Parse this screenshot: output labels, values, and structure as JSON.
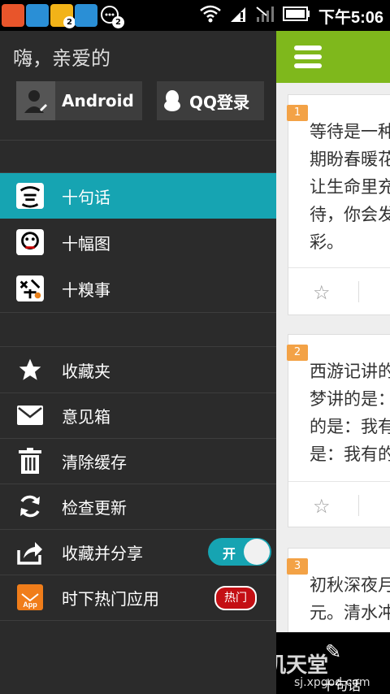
{
  "status_bar": {
    "time": "下午5:06",
    "notification_counts": [
      "2",
      "2"
    ]
  },
  "drawer": {
    "greeting": "嗨，亲爱的",
    "login_android": "Android",
    "login_qq": "QQ登录",
    "categories": [
      {
        "label": "十句话",
        "active": true
      },
      {
        "label": "十幅图",
        "active": false
      },
      {
        "label": "十糗事",
        "active": false
      }
    ],
    "menu": [
      {
        "label": "收藏夹"
      },
      {
        "label": "意见箱"
      },
      {
        "label": "清除缓存"
      },
      {
        "label": "检查更新"
      },
      {
        "label": "收藏并分享"
      },
      {
        "label": "时下热门应用"
      }
    ],
    "share_toggle": {
      "label": "开",
      "on": true
    },
    "hot_badge": "热门",
    "app_icon_label": "App"
  },
  "content": {
    "cards": [
      {
        "num": "1",
        "lines": [
          "等待是一种",
          "期盼春暖花",
          "让生命里充",
          "待，你会发",
          "彩。"
        ]
      },
      {
        "num": "2",
        "lines": [
          "西游记讲的",
          "梦讲的是：",
          "的是：我有",
          "是：我有的"
        ]
      },
      {
        "num": "3",
        "lines": [
          "初秋深夜月",
          "元。清水冲"
        ]
      }
    ],
    "bottom_nav_label": "十句话"
  },
  "watermark": {
    "title": "手机天堂",
    "url": "sj.xpgod.com"
  },
  "colors": {
    "accent": "#16a4b2",
    "header_green": "#7fb81c",
    "drawer_bg": "#2b2b2b",
    "hot_red": "#c40f14",
    "card_num_orange": "#f3a246"
  }
}
